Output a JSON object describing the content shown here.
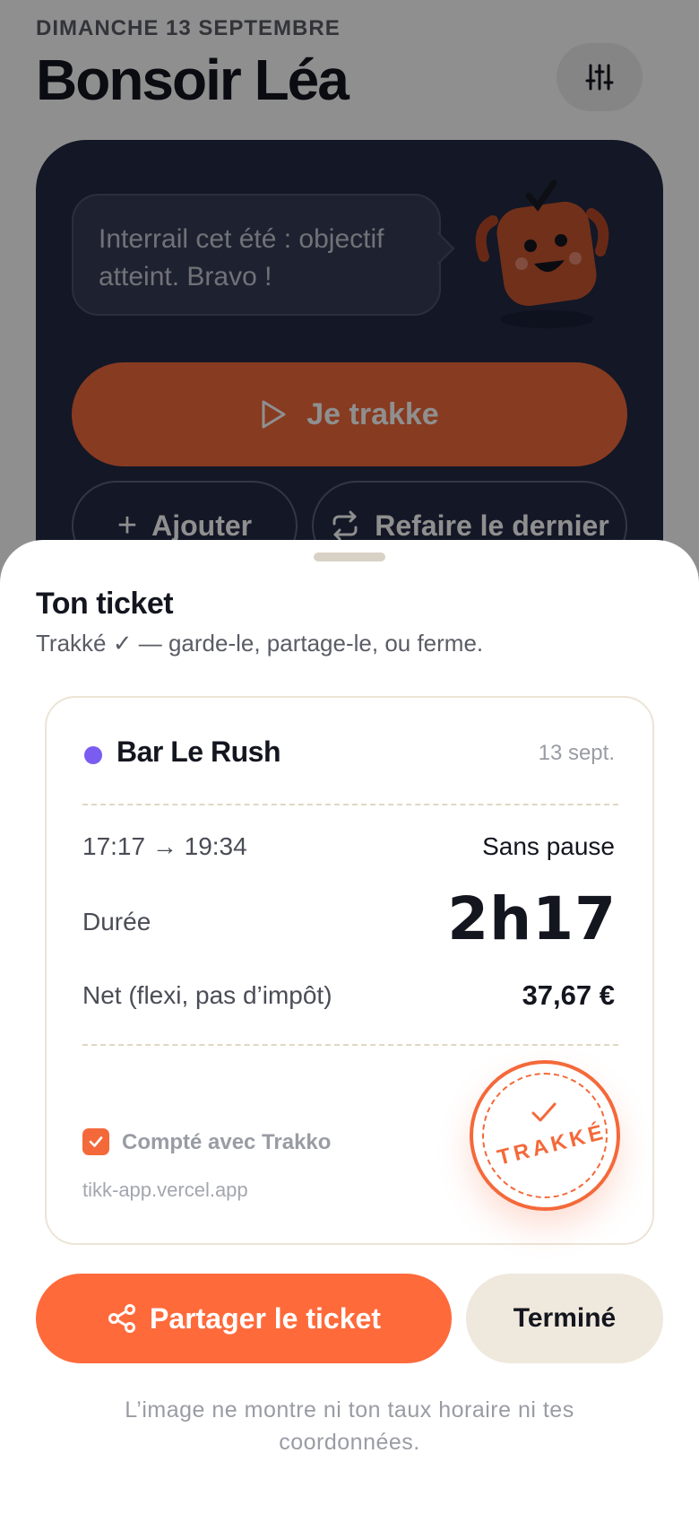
{
  "header": {
    "date": "DIMANCHE 13 SEPTEMBRE",
    "greeting": "Bonsoir Léa",
    "settings_icon": "sliders-icon"
  },
  "hero": {
    "speech": "Interrail cet été : objectif atteint. Bravo !",
    "mascot": "mascot-character",
    "track_label": "Je trakke",
    "add_label": "Ajouter",
    "redo_label": "Refaire le dernier"
  },
  "sheet": {
    "title": "Ton ticket",
    "subtitle": "Trakké ✓ — garde-le, partage-le, ou ferme."
  },
  "ticket": {
    "venue": "Bar Le Rush",
    "venue_color": "#7a5cf0",
    "date": "13 sept.",
    "time_range": "17:17 → 19:34",
    "pause": "Sans pause",
    "duration_label": "Durée",
    "duration_value": "2h17",
    "net_label": "Net (flexi, pas d’impôt)",
    "net_value": "37,67 €",
    "counted_label": "Compté avec Trakko",
    "counted_checked": true,
    "url": "tikk-app.vercel.app",
    "stamp_text": "TRAKKÉ"
  },
  "actions": {
    "share_label": "Partager le ticket",
    "done_label": "Terminé"
  },
  "footnote": "L’image ne montre ni ton taux horaire ni tes coordonnées.",
  "colors": {
    "accent": "#ff6a3b",
    "hero_bg": "#232a45",
    "done_bg": "#efe8dc"
  }
}
